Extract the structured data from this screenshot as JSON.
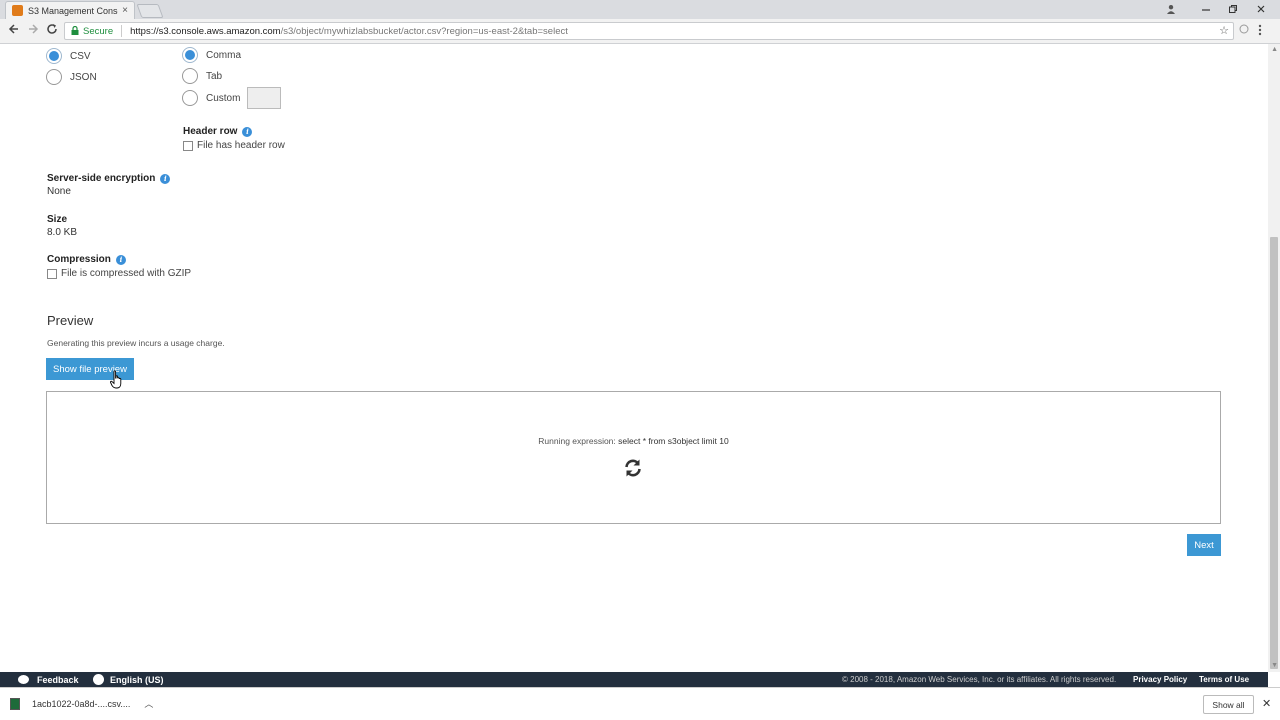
{
  "browser": {
    "tab_title": "S3 Management Console",
    "tab_close": "×",
    "secure_label": "Secure",
    "url_host": "https://s3.console.aws.amazon.com",
    "url_path": "/s3/object/mywhizlabsbucket/actor.csv?region=us-east-2&tab=select"
  },
  "format": {
    "options": [
      {
        "label": "CSV",
        "selected": true
      },
      {
        "label": "JSON",
        "selected": false
      }
    ]
  },
  "delimiter": {
    "options": [
      {
        "label": "Comma",
        "selected": true
      },
      {
        "label": "Tab",
        "selected": false
      },
      {
        "label": "Custom",
        "selected": false
      }
    ]
  },
  "header_row": {
    "label": "Header row",
    "checkbox_label": "File has header row"
  },
  "encryption": {
    "label": "Server-side encryption",
    "value": "None"
  },
  "size": {
    "label": "Size",
    "value": "8.0 KB"
  },
  "compression": {
    "label": "Compression",
    "checkbox_label": "File is compressed with GZIP"
  },
  "preview": {
    "heading": "Preview",
    "note": "Generating this preview incurs a usage charge.",
    "button_label": "Show file preview",
    "running_label": "Running expression:",
    "expression": "select * from s3object limit 10"
  },
  "next_label": "Next",
  "footer": {
    "feedback": "Feedback",
    "language": "English (US)",
    "copyright": "© 2008 - 2018, Amazon Web Services, Inc. or its affiliates. All rights reserved.",
    "privacy": "Privacy Policy",
    "terms": "Terms of Use"
  },
  "downloads": {
    "file_name": "1acb1022-0a8d-....csv....",
    "show_all": "Show all"
  },
  "colors": {
    "accent": "#3c98d4",
    "footer_bg": "#232f3e"
  }
}
